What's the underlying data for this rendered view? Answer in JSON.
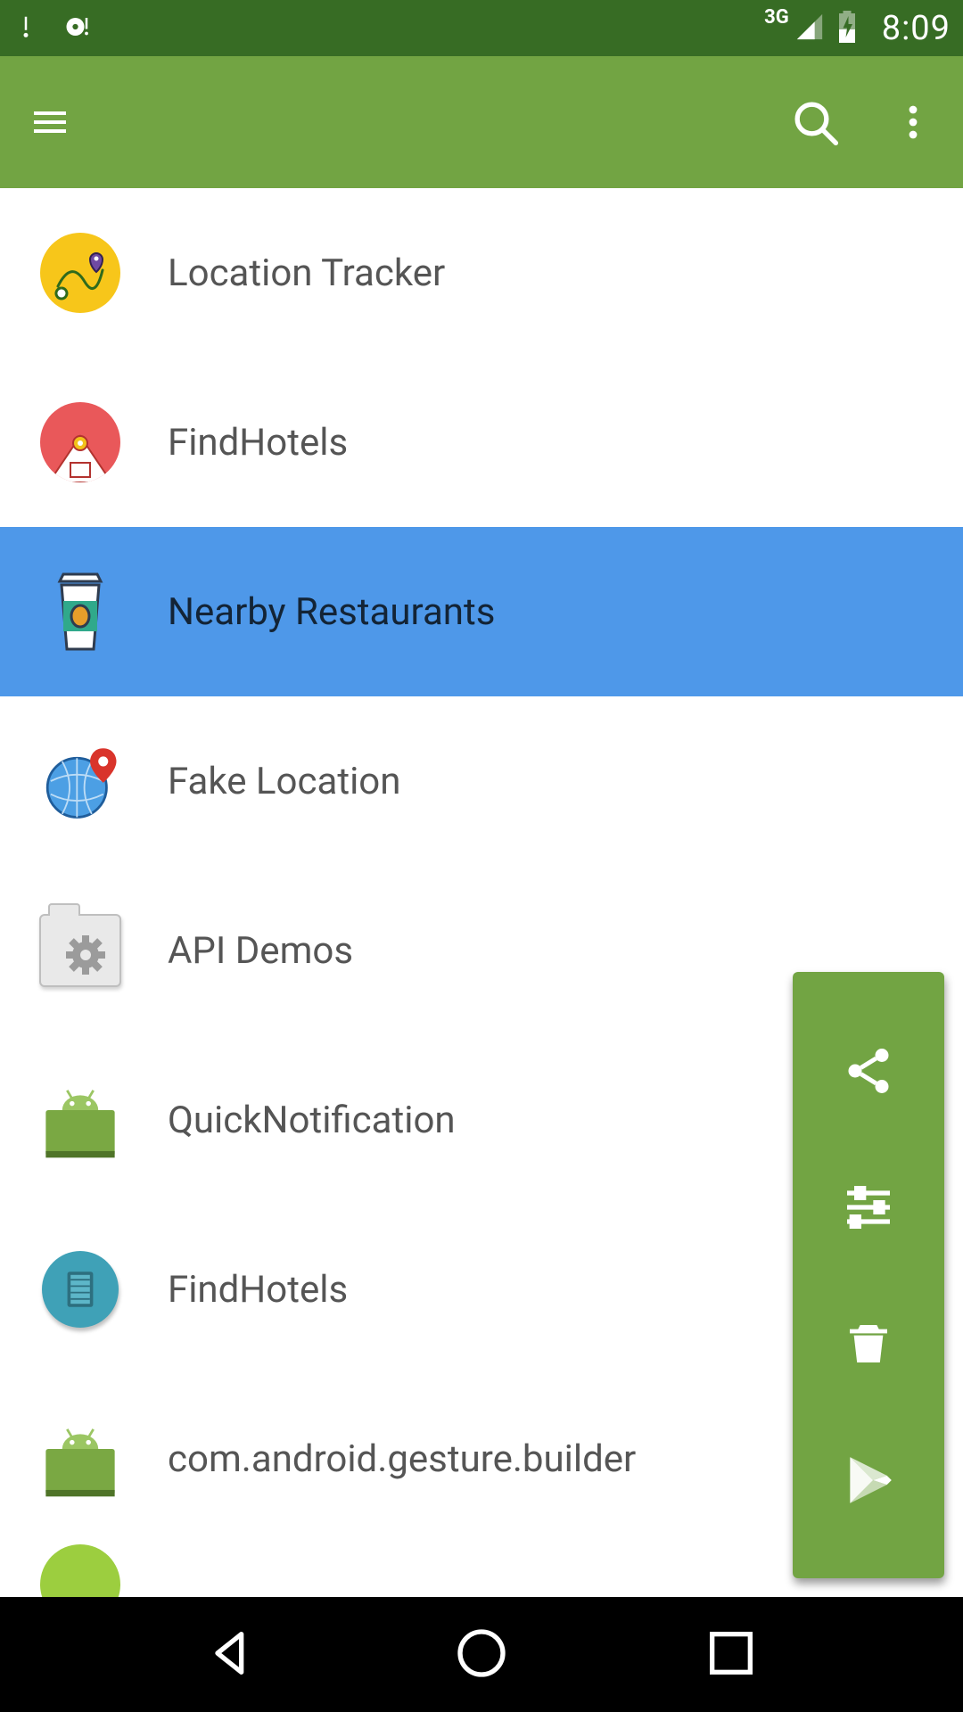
{
  "status": {
    "network": "3G",
    "time": "8:09"
  },
  "action_icons": {
    "menu": "menu-icon",
    "search": "search-icon",
    "overflow": "overflow-icon"
  },
  "list": {
    "items": [
      {
        "id": "location-tracker",
        "label": "Location Tracker",
        "icon": "location-tracker-icon",
        "selected": false
      },
      {
        "id": "findhotels-a",
        "label": "FindHotels",
        "icon": "findhotels-red-icon",
        "selected": false
      },
      {
        "id": "nearby-restaurants",
        "label": "Nearby Restaurants",
        "icon": "coffee-cup-icon",
        "selected": true
      },
      {
        "id": "fake-location",
        "label": "Fake Location",
        "icon": "globe-pin-icon",
        "selected": false
      },
      {
        "id": "api-demos",
        "label": "API Demos",
        "icon": "folder-gear-icon",
        "selected": false
      },
      {
        "id": "quicknotification",
        "label": "QuickNotification",
        "icon": "android-icon",
        "selected": false
      },
      {
        "id": "findhotels-b",
        "label": "FindHotels",
        "icon": "findhotels-teal-icon",
        "selected": false
      },
      {
        "id": "gesture-builder",
        "label": "com.android.gesture.builder",
        "icon": "android-icon",
        "selected": false
      }
    ]
  },
  "panel": {
    "actions": [
      {
        "id": "share",
        "icon": "share-icon"
      },
      {
        "id": "tune",
        "icon": "tune-icon"
      },
      {
        "id": "delete",
        "icon": "trash-icon"
      },
      {
        "id": "play",
        "icon": "play-store-icon"
      }
    ]
  },
  "nav": {
    "back": "back-icon",
    "home": "home-icon",
    "recent": "recent-icon"
  },
  "colors": {
    "status_bar": "#376c24",
    "action_bar": "#72a443",
    "selection": "#4e98e9",
    "panel": "#72a443"
  }
}
